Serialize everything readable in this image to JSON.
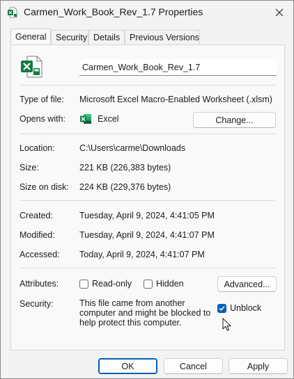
{
  "window": {
    "title": "Carmen_Work_Book_Rev_1.7 Properties"
  },
  "tabs": [
    {
      "label": "General",
      "active": true
    },
    {
      "label": "Security",
      "active": false
    },
    {
      "label": "Details",
      "active": false
    },
    {
      "label": "Previous Versions",
      "active": false
    }
  ],
  "general": {
    "filename": "Carmen_Work_Book_Rev_1.7",
    "type_label": "Type of file:",
    "type_value": "Microsoft Excel Macro-Enabled Worksheet (.xlsm)",
    "opens_label": "Opens with:",
    "opens_value": "Excel",
    "change_button": "Change...",
    "location_label": "Location:",
    "location_value": "C:\\Users\\carme\\Downloads",
    "size_label": "Size:",
    "size_value": "221 KB (226,383 bytes)",
    "size_on_disk_label": "Size on disk:",
    "size_on_disk_value": "224 KB (229,376 bytes)",
    "created_label": "Created:",
    "created_value": "Tuesday, April 9, 2024, 4:41:05 PM",
    "modified_label": "Modified:",
    "modified_value": "Tuesday, April 9, 2024, 4:41:07 PM",
    "accessed_label": "Accessed:",
    "accessed_value": "Today, April 9, 2024, 4:41:07 PM",
    "attributes_label": "Attributes:",
    "readonly_label": "Read-only",
    "readonly_checked": false,
    "hidden_label": "Hidden",
    "hidden_checked": false,
    "advanced_button": "Advanced...",
    "security_label": "Security:",
    "security_text": "This file came from another computer and might be blocked to help protect this computer.",
    "unblock_label": "Unblock",
    "unblock_checked": true
  },
  "footer": {
    "ok": "OK",
    "cancel": "Cancel",
    "apply": "Apply"
  },
  "colors": {
    "excel_green": "#107c41",
    "accent": "#005fb8"
  },
  "icons": [
    "excel-file-icon",
    "excel-app-icon",
    "close-icon",
    "checkmark-icon",
    "mouse-pointer-icon"
  ]
}
